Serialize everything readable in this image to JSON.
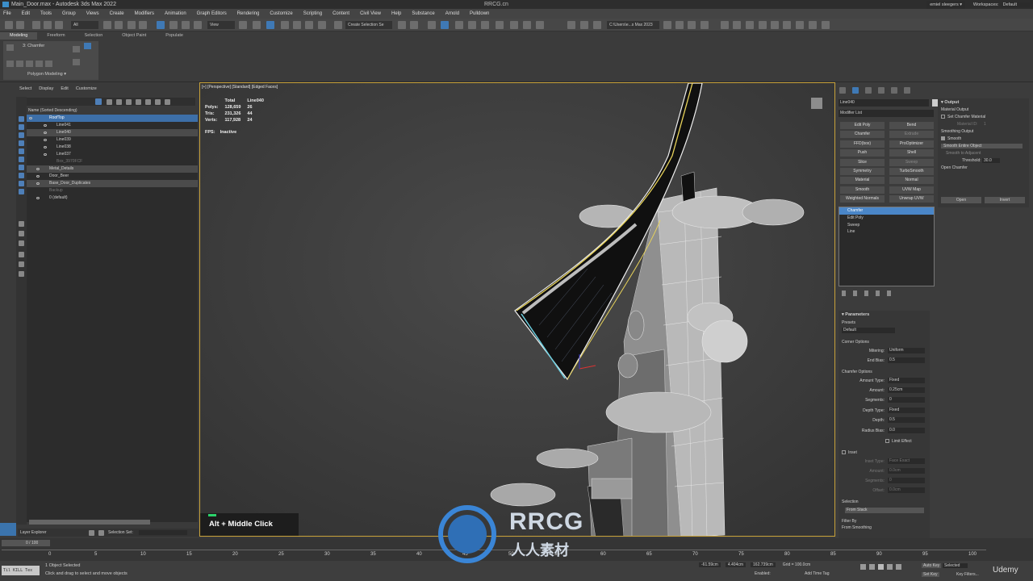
{
  "app": {
    "title": "Main_Door.max - Autodesk 3ds Max 2022",
    "user": "emiel sleegers",
    "workspace_label": "Workspaces:",
    "workspace_value": "Default"
  },
  "menu": [
    "File",
    "Edit",
    "Tools",
    "Group",
    "Views",
    "Create",
    "Modifiers",
    "Animation",
    "Graph Editors",
    "Rendering",
    "Customize",
    "Scripting",
    "Content",
    "Civil View",
    "Help",
    "Substance",
    "Arnold",
    "Pulldown"
  ],
  "toolbar": {
    "selection_filter": "All",
    "ref_coord": "View",
    "create_selection_set": "Create Selection Se",
    "project_path": "C:\\Users\\e...s Max 2023"
  },
  "ribbon": {
    "tabs": [
      "Modeling",
      "Freeform",
      "Selection",
      "Object Paint",
      "Populate"
    ],
    "active_tab": "Modeling",
    "chamfer_label": "3: Chamfer",
    "panel_label": "Polygon Modeling"
  },
  "scene_explorer": {
    "menu": [
      "Select",
      "Display",
      "Edit",
      "Customize"
    ],
    "column_header": "Name (Sorted Descending)",
    "rows": [
      {
        "label": "RoofTop",
        "indent": 0,
        "state": "hi"
      },
      {
        "label": "Line041",
        "indent": 1,
        "state": ""
      },
      {
        "label": "Line040",
        "indent": 1,
        "state": "sel"
      },
      {
        "label": "Line039",
        "indent": 1,
        "state": ""
      },
      {
        "label": "Line038",
        "indent": 1,
        "state": ""
      },
      {
        "label": "Line037",
        "indent": 1,
        "state": ""
      },
      {
        "label": "Box_3970FCF",
        "indent": 1,
        "state": "dim"
      },
      {
        "label": "Metal_Details",
        "indent": 0,
        "state": ""
      },
      {
        "label": "Door_Beer",
        "indent": 0,
        "state": ""
      },
      {
        "label": "Base_Door_Duplicates",
        "indent": 0,
        "state": ""
      },
      {
        "label": "Backup",
        "indent": 0,
        "state": "dim"
      },
      {
        "label": "0 (default)",
        "indent": 0,
        "state": ""
      }
    ],
    "footer_layer": "Layer Explorer",
    "footer_selset": "Selection Set:"
  },
  "viewport": {
    "label": "[+] [Perspective] [Standard] [Edged Faces]",
    "stats": {
      "head": [
        "",
        "Total",
        "Line040"
      ],
      "rows": [
        [
          "Polys:",
          "128,659",
          "26"
        ],
        [
          "Tris:",
          "231,326",
          "44"
        ],
        [
          "Verts:",
          "117,928",
          "24"
        ]
      ]
    },
    "fps_label": "FPS:",
    "fps_value": "Inactive",
    "keycast": "Alt + Middle Click"
  },
  "command_panel": {
    "object_name": "Line040",
    "modifier_list": "Modifier List",
    "modifier_buttons": [
      [
        "Edit Poly",
        "Bend"
      ],
      [
        "Chamfer",
        "Extrude"
      ],
      [
        "FFD(box)",
        "ProOptimizer"
      ],
      [
        "Push",
        "Shell"
      ],
      [
        "Slice",
        "Sweep"
      ],
      [
        "Symmetry",
        "TurboSmooth"
      ],
      [
        "Material",
        "Normal"
      ],
      [
        "Smooth",
        "UVW Map"
      ],
      [
        "Weighted Normals",
        "Unwrap UVW"
      ]
    ],
    "stack": [
      {
        "label": "Chamfer",
        "hi": true
      },
      {
        "label": "Edit Poly",
        "hi": false
      },
      {
        "label": "Sweep",
        "hi": false
      },
      {
        "label": "Line",
        "hi": false
      }
    ],
    "output": {
      "title": "Output",
      "material_output": "Material Output",
      "set_chamfer_material": "Set Chamfer Material",
      "material_id_label": "Material ID:",
      "material_id_value": "1",
      "smoothing_output": "Smoothing Output",
      "smooth": "Smooth",
      "smooth_mode": "Smooth Entire Object",
      "smooth_adjacent": "Smooth to Adjacent",
      "threshold_label": "Threshold:",
      "threshold_value": "30.0",
      "open_chamfer": "Open Chamfer",
      "open_btn": "Open",
      "invert_btn": "Invert"
    },
    "params": {
      "title": "Parameters",
      "presets_label": "Presets",
      "presets_value": "Default",
      "corner_options": "Corner Options",
      "mitering_label": "Mitering:",
      "mitering_value": "Uniform",
      "end_bias_label": "End Bias:",
      "end_bias_value": "0.5",
      "chamfer_options": "Chamfer Options",
      "amount_type_label": "Amount Type:",
      "amount_type_value": "Fixed",
      "amount_label": "Amount:",
      "amount_value": "0.25cm",
      "segments_label": "Segments:",
      "segments_value": "0",
      "depth_type_label": "Depth Type:",
      "depth_type_value": "Fixed",
      "depth_label": "Depth:",
      "depth_value": "0.5",
      "radius_bias_label": "Radius Bias:",
      "radius_bias_value": "0.0",
      "limit_effect": "Limit Effect",
      "inset": "Inset",
      "inset_type_label": "Inset Type:",
      "inset_type_value": "Face Exact",
      "inset_amount_label": "Amount:",
      "inset_amount_value": "0.0cm",
      "inset_segments_label": "Segments:",
      "inset_segments_value": "0",
      "inset_offset_label": "Offset:",
      "inset_offset_value": "0.0cm",
      "selection_label": "Selection",
      "selection_value": "From Stack",
      "filter_by_label": "Filter By",
      "from_smoothing": "From Smoothing"
    }
  },
  "timeline": {
    "frame": "0 / 100",
    "ticks": [
      "0",
      "5",
      "10",
      "15",
      "20",
      "25",
      "30",
      "35",
      "40",
      "45",
      "50",
      "55",
      "60",
      "65",
      "70",
      "75",
      "80",
      "85",
      "90",
      "95",
      "100"
    ]
  },
  "status": {
    "maxscript": "Til KILL Tex",
    "selected": "1 Object Selected",
    "hint": "Click and drag to select and move objects",
    "x": "-61.59cm",
    "y": "4.404cm",
    "z": "162.739cm",
    "grid": "Grid = 100.0cm",
    "enabled": "Enabled:",
    "add_time_tag": "Add Time Tag",
    "autokey": "Auto Key",
    "selected_mode": "Selected",
    "setkey": "Set Key",
    "key_filters": "Key Filters..."
  },
  "watermark": {
    "top": "RRCG",
    "sub": "人人素材",
    "site": "RRCG.cn",
    "udemy": "Udemy"
  },
  "colors": {
    "accent": "#3f79b5",
    "viewport_border": "#c8a23a",
    "keycast_bar": "#2bd36b"
  }
}
